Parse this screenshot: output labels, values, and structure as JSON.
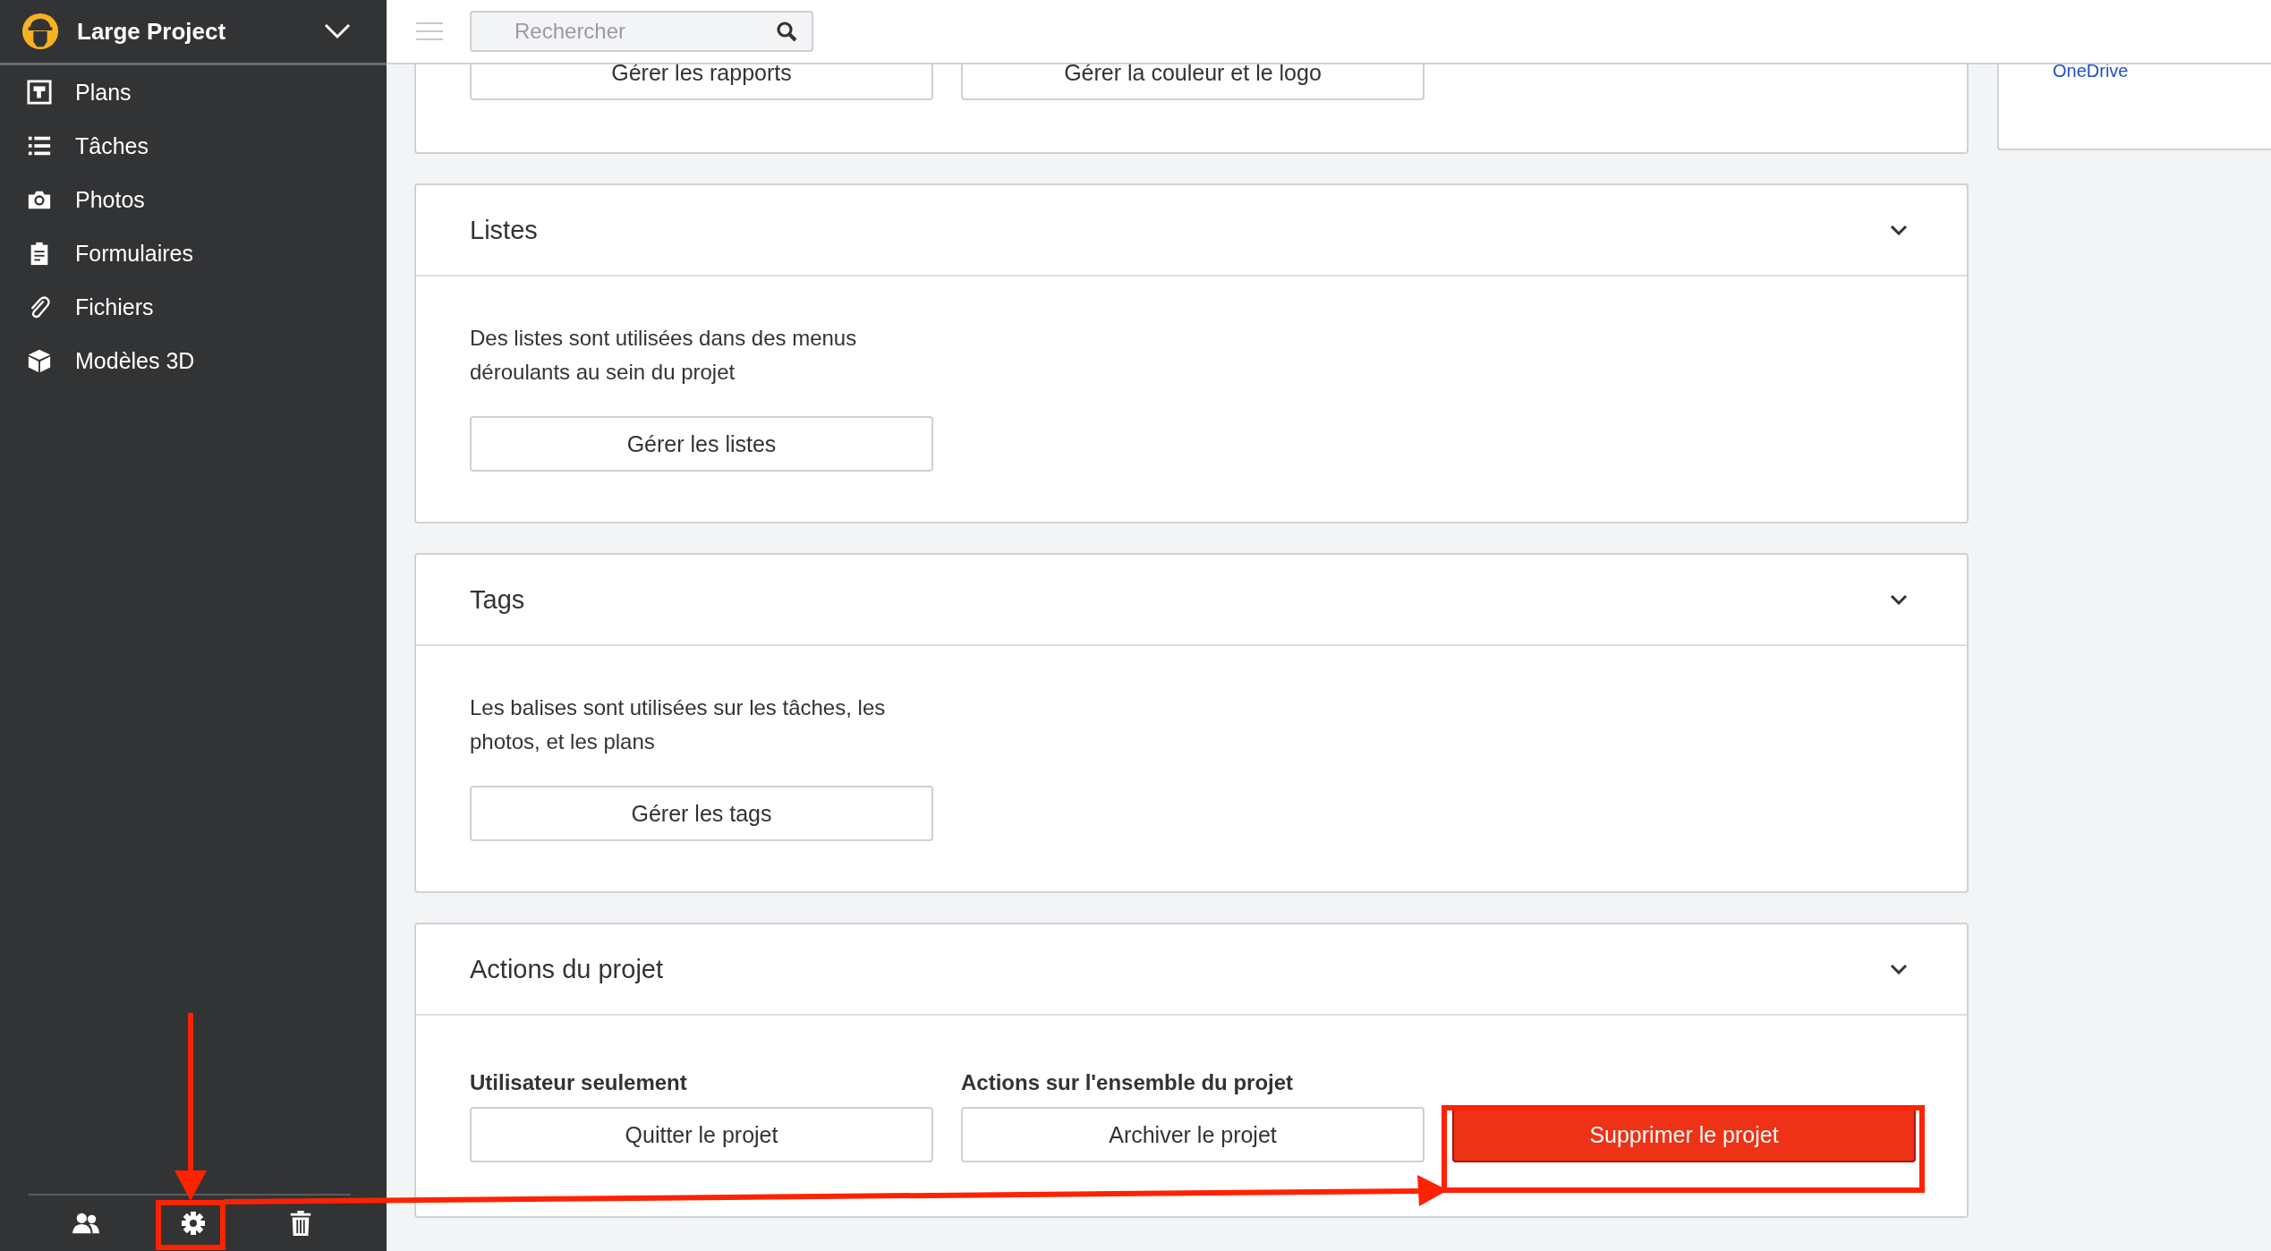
{
  "sidebar": {
    "project_name": "Large Project",
    "items": [
      {
        "label": "Plans"
      },
      {
        "label": "Tâches"
      },
      {
        "label": "Photos"
      },
      {
        "label": "Formulaires"
      },
      {
        "label": "Fichiers"
      },
      {
        "label": "Modèles 3D"
      }
    ]
  },
  "topbar": {
    "search": {
      "placeholder": "Rechercher"
    }
  },
  "sections": [
    {
      "kind": "partial",
      "buttons": [
        "Gérer les rapports",
        "Gérer la couleur et le logo"
      ]
    },
    {
      "kind": "text",
      "title": "Listes",
      "expanded": true,
      "description": "Des listes sont utilisées dans des menus déroulants au sein du projet",
      "buttons": [
        "Gérer les listes"
      ]
    },
    {
      "kind": "text",
      "title": "Tags",
      "expanded": true,
      "description": "Les balises sont utilisées sur les tâches, les photos, et les plans",
      "buttons": [
        "Gérer les tags"
      ]
    },
    {
      "kind": "actions",
      "title": "Actions du projet",
      "expanded": true,
      "columns": [
        {
          "heading": "Utilisateur seulement",
          "button": {
            "label": "Quitter le projet",
            "kind": "outline"
          }
        },
        {
          "heading": "Actions sur l'ensemble du projet",
          "button": {
            "label": "Archiver le projet",
            "kind": "outline"
          }
        },
        {
          "button": {
            "label": "Supprimer le projet",
            "kind": "danger"
          }
        }
      ]
    }
  ],
  "side_panel": {
    "link": "OneDrive"
  }
}
